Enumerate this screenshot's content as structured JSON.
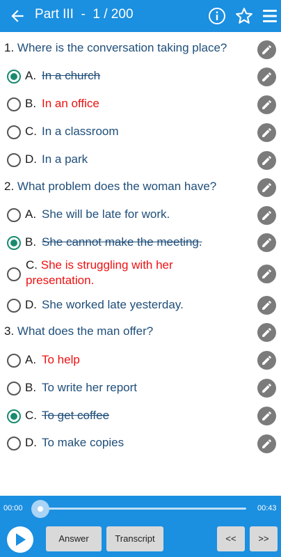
{
  "header": {
    "title": "Part III  -  1 / 200",
    "icons": [
      "back-arrow-icon",
      "info-icon",
      "star-icon",
      "menu-icon"
    ]
  },
  "questions": [
    {
      "num": "1.",
      "text": "Where is the conversation taking place?",
      "options": [
        {
          "letter": "A.",
          "text": "In a church",
          "state": "selected-struck"
        },
        {
          "letter": "B.",
          "text": "In an office",
          "state": "red"
        },
        {
          "letter": "C.",
          "text": "In a classroom",
          "state": "normal"
        },
        {
          "letter": "D.",
          "text": "In a park",
          "state": "normal"
        }
      ]
    },
    {
      "num": "2.",
      "text": "What problem does the woman have?",
      "options": [
        {
          "letter": "A.",
          "text": "She will be late for work.",
          "state": "normal"
        },
        {
          "letter": "B.",
          "text": "She cannot make the meeting.",
          "state": "selected-struck"
        },
        {
          "letter": "C.",
          "text": "She is struggling with her presentation.",
          "state": "red"
        },
        {
          "letter": "D.",
          "text": "She worked late yesterday.",
          "state": "normal"
        }
      ]
    },
    {
      "num": "3.",
      "text": "What does the man offer?",
      "options": [
        {
          "letter": "A.",
          "text": "To help",
          "state": "red"
        },
        {
          "letter": "B.",
          "text": "To write her report",
          "state": "normal"
        },
        {
          "letter": "C.",
          "text": "To get coffee",
          "state": "selected-struck"
        },
        {
          "letter": "D.",
          "text": "To make copies",
          "state": "normal"
        }
      ]
    }
  ],
  "player": {
    "time_current": "00:00",
    "time_total": "00:43",
    "progress": 0,
    "buttons": {
      "answer": "Answer",
      "transcript": "Transcript",
      "prev": "<<",
      "next": ">>"
    }
  },
  "colors": {
    "accent": "#1b8fe0",
    "question_text": "#1f4e79",
    "wrong_red": "#ee1111",
    "selected_green": "#1a8a6e",
    "edit_gray": "#7b7b7b"
  }
}
